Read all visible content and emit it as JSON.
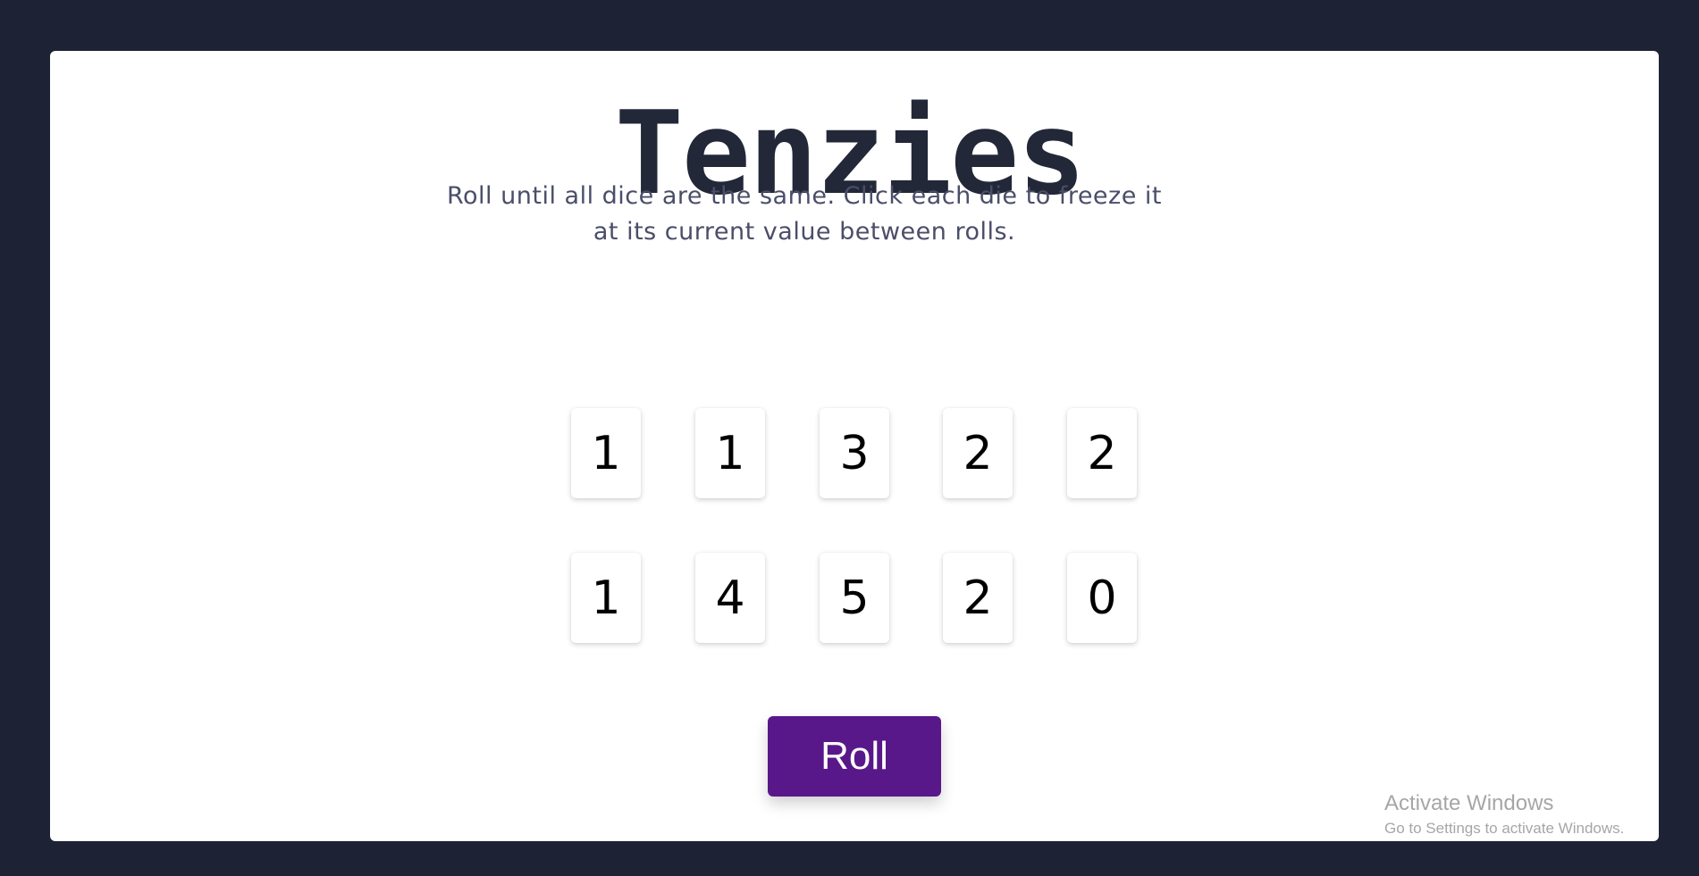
{
  "game": {
    "title": "Tenzies",
    "instructions": "Roll until all dice are the same. Click each die to freeze it at its current value between rolls.",
    "dice": [
      "1",
      "1",
      "3",
      "2",
      "2",
      "1",
      "4",
      "5",
      "2",
      "0"
    ],
    "roll_label": "Roll"
  },
  "watermark": {
    "title": "Activate Windows",
    "subtitle": "Go to Settings to activate Windows."
  },
  "colors": {
    "page_background": "#1e2235",
    "card_background": "#ffffff",
    "title": "#222838",
    "roll_button": "#59188a"
  }
}
